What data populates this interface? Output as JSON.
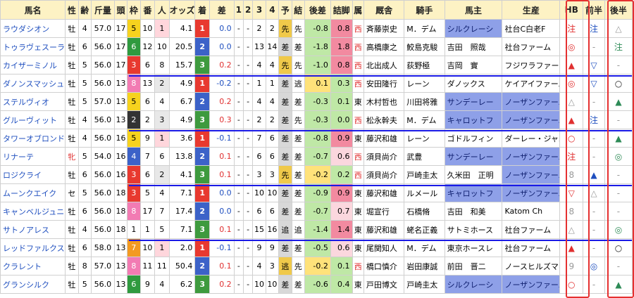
{
  "headers": [
    "馬名",
    "性",
    "齢",
    "斤量",
    "頭",
    "枠",
    "番",
    "人",
    "オッズ",
    "着",
    "差",
    "1",
    "2",
    "3",
    "4",
    "予",
    "結",
    "後差",
    "詰脚",
    "属",
    "厩舎",
    "騎手",
    "馬主",
    "生産",
    "HB",
    "前半",
    "後半"
  ],
  "rows": [
    {
      "name": "ラウダシオン",
      "sex": "牡",
      "age": "4",
      "kin": "57.0",
      "heads": "17",
      "gate": "5",
      "num": "10",
      "pop": "1",
      "odds": "4.1",
      "fin": "1",
      "diff": "0.0",
      "c1": "-",
      "c2": "-",
      "c3": "2",
      "c4": "2",
      "yoso": "先",
      "res": "先",
      "gosa": "-0.8",
      "tsume": "0.8",
      "belong": "西",
      "trainer": "斉藤崇史",
      "jockey": "M．デム",
      "owner": "シルクレーシ",
      "farm": "社台C白老F",
      "hb": "注",
      "zen": "注",
      "kou": "△"
    },
    {
      "name": "トゥラヴェスーラ",
      "sex": "牡",
      "age": "6",
      "kin": "56.0",
      "heads": "17",
      "gate": "6",
      "num": "12",
      "pop": "10",
      "odds": "20.5",
      "fin": "2",
      "diff": "0.0",
      "c1": "-",
      "c2": "-",
      "c3": "13",
      "c4": "14",
      "yoso": "差",
      "res": "差",
      "gosa": "-1.8",
      "tsume": "1.8",
      "belong": "西",
      "trainer": "高橋康之",
      "jockey": "鮫島克駿",
      "owner": "吉田　照哉",
      "farm": "社台ファーム",
      "hb": "◎",
      "zen": "-",
      "kou": "注"
    },
    {
      "name": "カイザーミノル",
      "sex": "牡",
      "age": "5",
      "kin": "56.0",
      "heads": "17",
      "gate": "3",
      "num": "6",
      "pop": "8",
      "odds": "15.7",
      "fin": "3",
      "diff": "0.2",
      "c1": "-",
      "c2": "-",
      "c3": "4",
      "c4": "4",
      "yoso": "先",
      "res": "先",
      "gosa": "-1.0",
      "tsume": "0.8",
      "belong": "西",
      "trainer": "北出成人",
      "jockey": "荻野極",
      "owner": "吉岡　實",
      "farm": "フジワラファーム",
      "hb": "▲",
      "zen": "▽",
      "kou": "-"
    },
    {
      "name": "ダノンスマッシュ",
      "sex": "牡",
      "age": "5",
      "kin": "56.0",
      "heads": "13",
      "gate": "8",
      "num": "13",
      "pop": "2",
      "odds": "4.9",
      "fin": "1",
      "diff": "-0.2",
      "c1": "-",
      "c2": "-",
      "c3": "1",
      "c4": "1",
      "yoso": "差",
      "res": "逃",
      "gosa": "0.1",
      "tsume": "0.3",
      "belong": "西",
      "trainer": "安田隆行",
      "jockey": "レーン",
      "owner": "ダノックス",
      "farm": "ケイアイファーム",
      "hb": "◎",
      "zen": "▽",
      "kou": "○"
    },
    {
      "name": "ステルヴィオ",
      "sex": "牡",
      "age": "5",
      "kin": "57.0",
      "heads": "13",
      "gate": "5",
      "num": "6",
      "pop": "4",
      "odds": "6.7",
      "fin": "2",
      "diff": "0.2",
      "c1": "-",
      "c2": "-",
      "c3": "4",
      "c4": "4",
      "yoso": "差",
      "res": "差",
      "gosa": "-0.3",
      "tsume": "0.1",
      "belong": "東",
      "trainer": "木村哲也",
      "jockey": "川田将雅",
      "owner": "サンデーレー",
      "farm": "ノーザンファーム",
      "hb": "△",
      "zen": "-",
      "kou": "▲"
    },
    {
      "name": "グルーヴィット",
      "sex": "牡",
      "age": "4",
      "kin": "56.0",
      "heads": "13",
      "gate": "2",
      "num": "2",
      "pop": "3",
      "odds": "4.9",
      "fin": "3",
      "diff": "0.3",
      "c1": "-",
      "c2": "-",
      "c3": "2",
      "c4": "2",
      "yoso": "差",
      "res": "先",
      "gosa": "-0.3",
      "tsume": "0.0",
      "belong": "西",
      "trainer": "松永幹夫",
      "jockey": "M．デム",
      "owner": "キャロットフ",
      "farm": "ノーザンファーム",
      "hb": "▲",
      "zen": "注",
      "kou": "-"
    },
    {
      "name": "タワーオブロンドン",
      "sex": "牡",
      "age": "4",
      "kin": "56.0",
      "heads": "16",
      "gate": "5",
      "num": "9",
      "pop": "1",
      "odds": "3.6",
      "fin": "1",
      "diff": "-0.1",
      "c1": "-",
      "c2": "-",
      "c3": "7",
      "c4": "6",
      "yoso": "差",
      "res": "差",
      "gosa": "-0.8",
      "tsume": "0.9",
      "belong": "東",
      "trainer": "藤沢和雄",
      "jockey": "レーン",
      "owner": "ゴドルフィン",
      "farm": "ダーレー・ジャパ",
      "hb": "○",
      "zen": "-",
      "kou": "▲"
    },
    {
      "name": "リナーテ",
      "sex": "牝",
      "age": "5",
      "kin": "54.0",
      "heads": "16",
      "gate": "4",
      "num": "7",
      "pop": "6",
      "odds": "13.8",
      "fin": "2",
      "diff": "0.1",
      "c1": "-",
      "c2": "-",
      "c3": "6",
      "c4": "6",
      "yoso": "差",
      "res": "差",
      "gosa": "-0.7",
      "tsume": "0.6",
      "belong": "西",
      "trainer": "須貝尚介",
      "jockey": "武豊",
      "owner": "サンデーレー",
      "farm": "ノーザンファーム",
      "hb": "注",
      "zen": "-",
      "kou": "◎"
    },
    {
      "name": "ロジクライ",
      "sex": "牡",
      "age": "6",
      "kin": "56.0",
      "heads": "16",
      "gate": "3",
      "num": "6",
      "pop": "2",
      "odds": "4.1",
      "fin": "3",
      "diff": "0.1",
      "c1": "-",
      "c2": "-",
      "c3": "3",
      "c4": "3",
      "yoso": "先",
      "res": "差",
      "gosa": "-0.2",
      "tsume": "0.2",
      "belong": "西",
      "trainer": "須貝尚介",
      "jockey": "戸崎圭太",
      "owner": "久米田　正明",
      "farm": "ノーザンファーム",
      "hb": "8",
      "zen": "▲",
      "kou": "-"
    },
    {
      "name": "ムーンクエイク",
      "sex": "セ",
      "age": "5",
      "kin": "56.0",
      "heads": "18",
      "gate": "3",
      "num": "5",
      "pop": "4",
      "odds": "7.1",
      "fin": "1",
      "diff": "0.0",
      "c1": "-",
      "c2": "-",
      "c3": "10",
      "c4": "10",
      "yoso": "差",
      "res": "差",
      "gosa": "-0.9",
      "tsume": "0.9",
      "belong": "東",
      "trainer": "藤沢和雄",
      "jockey": "ルメール",
      "owner": "キャロットフ",
      "farm": "ノーザンファーム",
      "hb": "▽",
      "zen": "△",
      "kou": "-"
    },
    {
      "name": "キャンベルジュニア",
      "sex": "牡",
      "age": "6",
      "kin": "56.0",
      "heads": "18",
      "gate": "8",
      "num": "17",
      "pop": "7",
      "odds": "17.4",
      "fin": "2",
      "diff": "0.0",
      "c1": "-",
      "c2": "-",
      "c3": "6",
      "c4": "6",
      "yoso": "差",
      "res": "差",
      "gosa": "-0.7",
      "tsume": "0.7",
      "belong": "東",
      "trainer": "堀宣行",
      "jockey": "石橋脩",
      "owner": "吉田　和美",
      "farm": "Katom Ch",
      "hb": "8",
      "zen": "-",
      "kou": "-"
    },
    {
      "name": "サトノアレス",
      "sex": "牡",
      "age": "4",
      "kin": "56.0",
      "heads": "18",
      "gate": "1",
      "num": "1",
      "pop": "5",
      "odds": "7.1",
      "fin": "3",
      "diff": "0.1",
      "c1": "-",
      "c2": "-",
      "c3": "15",
      "c4": "16",
      "yoso": "追",
      "res": "追",
      "gosa": "-1.4",
      "tsume": "1.4",
      "belong": "東",
      "trainer": "藤沢和雄",
      "jockey": "蛯名正義",
      "owner": "サトミホース",
      "farm": "社台ファーム",
      "hb": "△",
      "zen": "-",
      "kou": "◎"
    },
    {
      "name": "レッドファルクス",
      "sex": "牡",
      "age": "6",
      "kin": "58.0",
      "heads": "13",
      "gate": "7",
      "num": "10",
      "pop": "1",
      "odds": "2.0",
      "fin": "1",
      "diff": "-0.1",
      "c1": "-",
      "c2": "-",
      "c3": "9",
      "c4": "9",
      "yoso": "差",
      "res": "差",
      "gosa": "-0.5",
      "tsume": "0.6",
      "belong": "東",
      "trainer": "尾関知人",
      "jockey": "M．デム",
      "owner": "東京ホースレ",
      "farm": "社台ファーム",
      "hb": "▲",
      "zen": "-",
      "kou": "○"
    },
    {
      "name": "クラレント",
      "sex": "牡",
      "age": "8",
      "kin": "57.0",
      "heads": "13",
      "gate": "8",
      "num": "11",
      "pop": "11",
      "odds": "50.4",
      "fin": "2",
      "diff": "0.1",
      "c1": "-",
      "c2": "-",
      "c3": "4",
      "c4": "3",
      "yoso": "逃",
      "res": "先",
      "gosa": "-0.2",
      "tsume": "0.1",
      "belong": "西",
      "trainer": "橋口慎介",
      "jockey": "岩田康誠",
      "owner": "前田　晋二",
      "farm": "ノースヒルズマネ",
      "hb": "9",
      "zen": "◎",
      "kou": "-"
    },
    {
      "name": "グランシルク",
      "sex": "牡",
      "age": "5",
      "kin": "56.0",
      "heads": "13",
      "gate": "6",
      "num": "9",
      "pop": "4",
      "odds": "6.2",
      "fin": "3",
      "diff": "0.2",
      "c1": "-",
      "c2": "-",
      "c3": "10",
      "c4": "10",
      "yoso": "差",
      "res": "差",
      "gosa": "-0.6",
      "tsume": "0.4",
      "belong": "東",
      "trainer": "戸田博文",
      "jockey": "戸崎圭太",
      "owner": "シルクレーシ",
      "farm": "ノーザンファーム",
      "hb": "○",
      "zen": "-",
      "kou": "▲"
    }
  ]
}
